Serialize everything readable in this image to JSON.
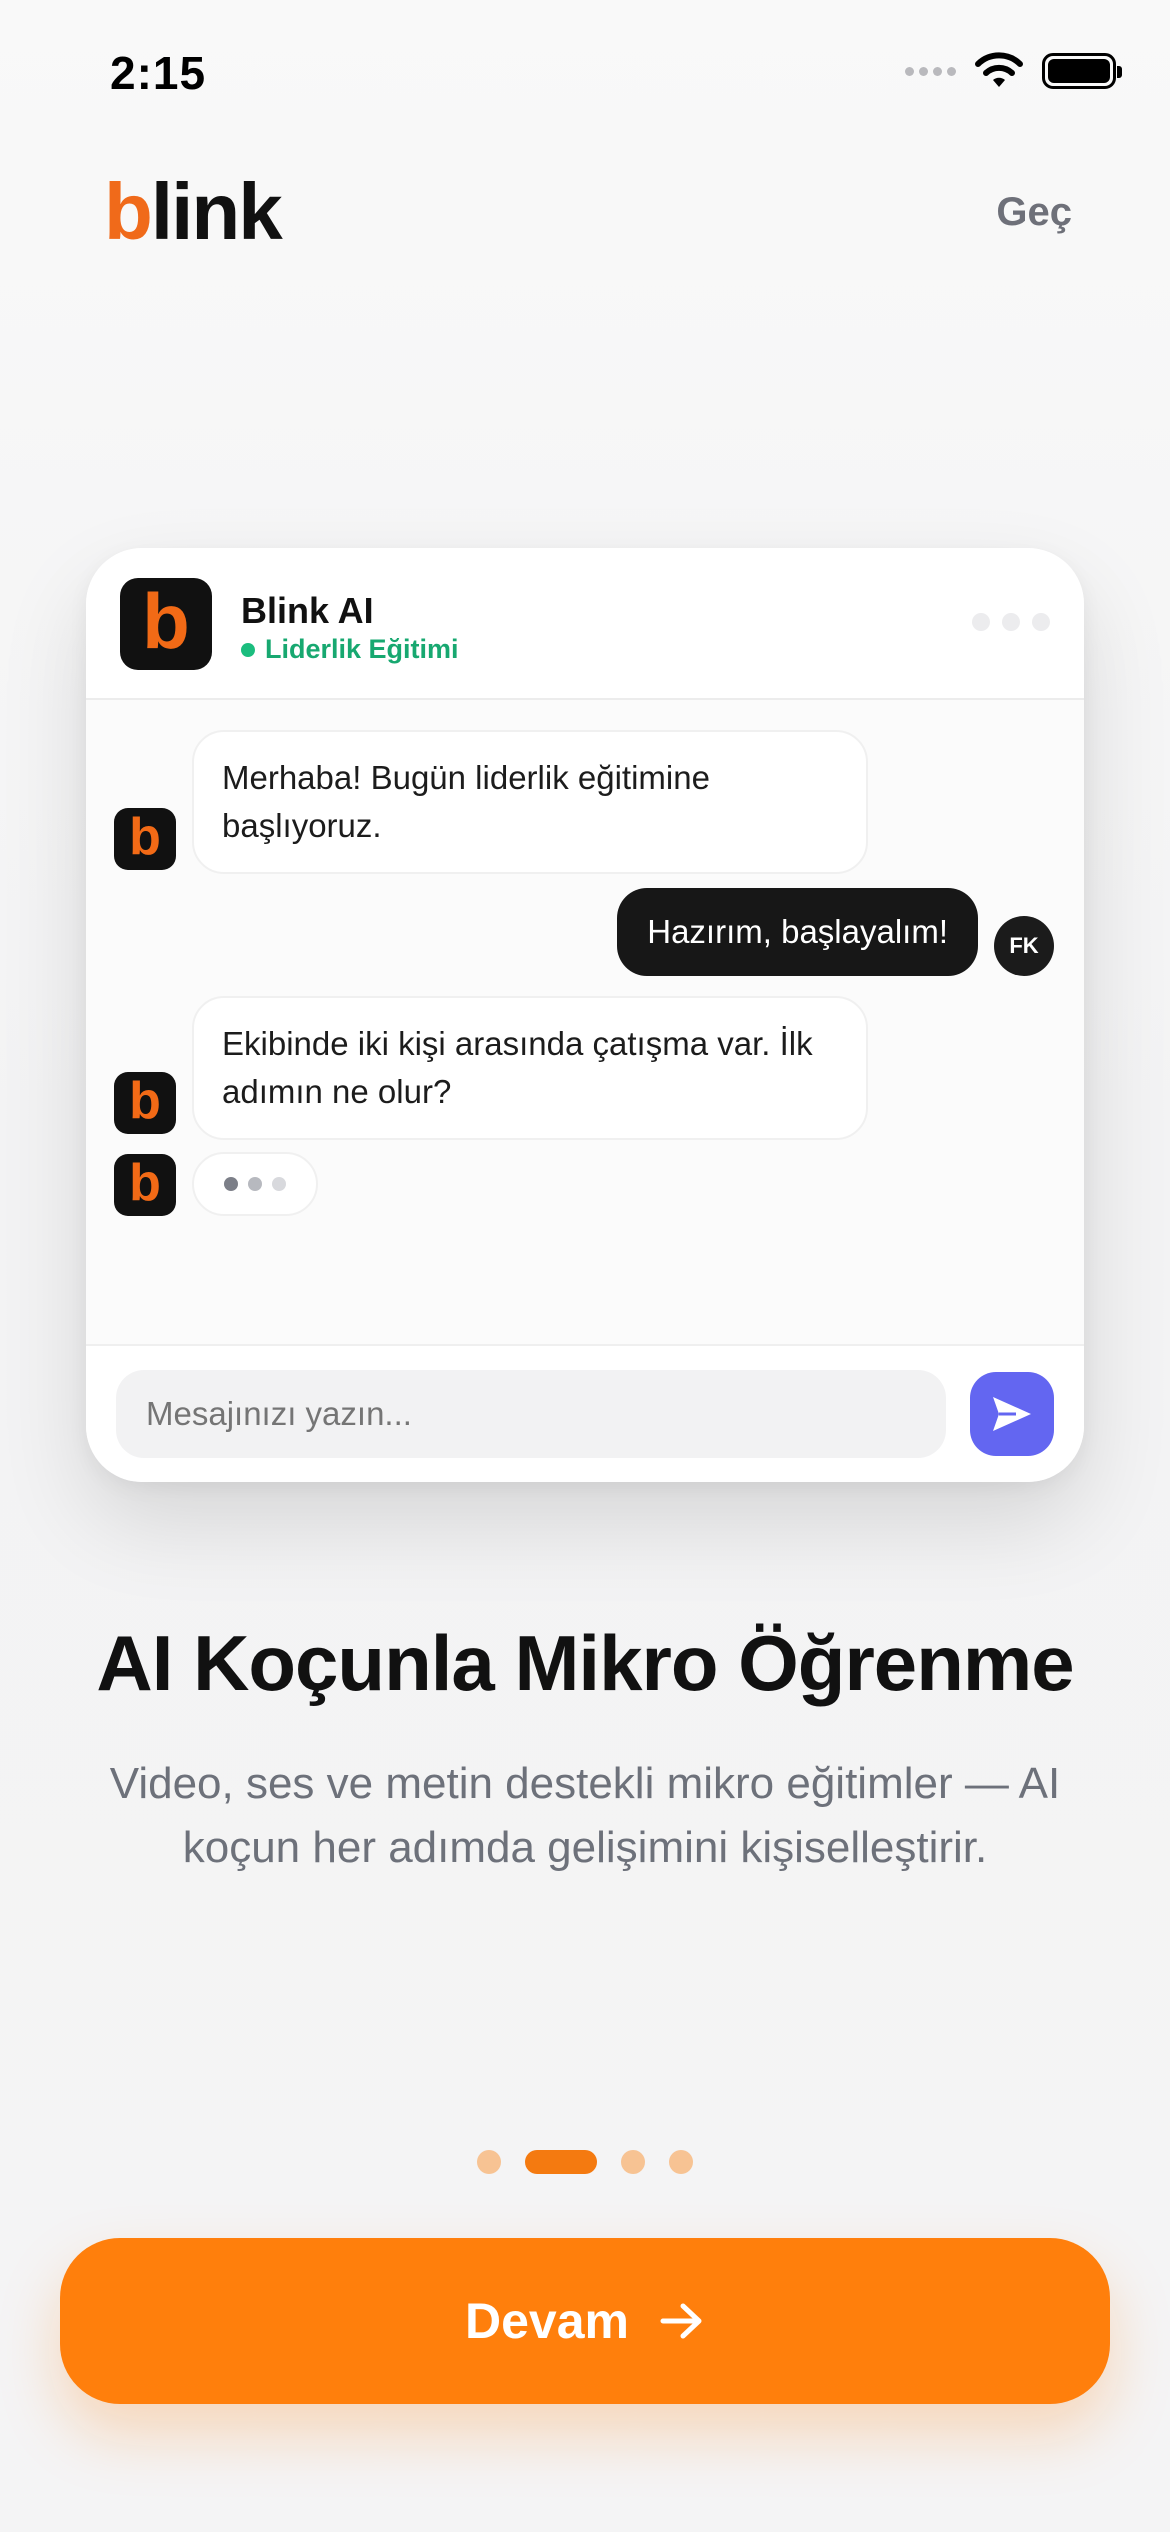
{
  "status_bar": {
    "time": "2:15"
  },
  "header": {
    "logo_b": "b",
    "logo_rest": "link",
    "skip_label": "Geç"
  },
  "chat": {
    "bot_name": "Blink AI",
    "bot_status": "Liderlik Eğitimi",
    "messages": [
      {
        "from": "bot",
        "text": "Merhaba! Bugün liderlik eğitimine başlıyoruz."
      },
      {
        "from": "user",
        "text": "Hazırım, başlayalım!",
        "avatar": "FK"
      },
      {
        "from": "bot",
        "text": "Ekibinde iki kişi arasında çatışma var. İlk adımın ne olur?"
      }
    ],
    "input_placeholder": "Mesajınızı yazın...",
    "accent": "#6366f1"
  },
  "onboarding": {
    "title": "AI Koçunla Mikro Öğrenme",
    "subtitle": "Video, ses ve metin destekli mikro eğitimler — AI koçun her adımda gelişimini kişiselleştirir.",
    "page_count": 4,
    "active_page": 2
  },
  "cta": {
    "label": "Devam",
    "color": "#ff7f0c"
  }
}
